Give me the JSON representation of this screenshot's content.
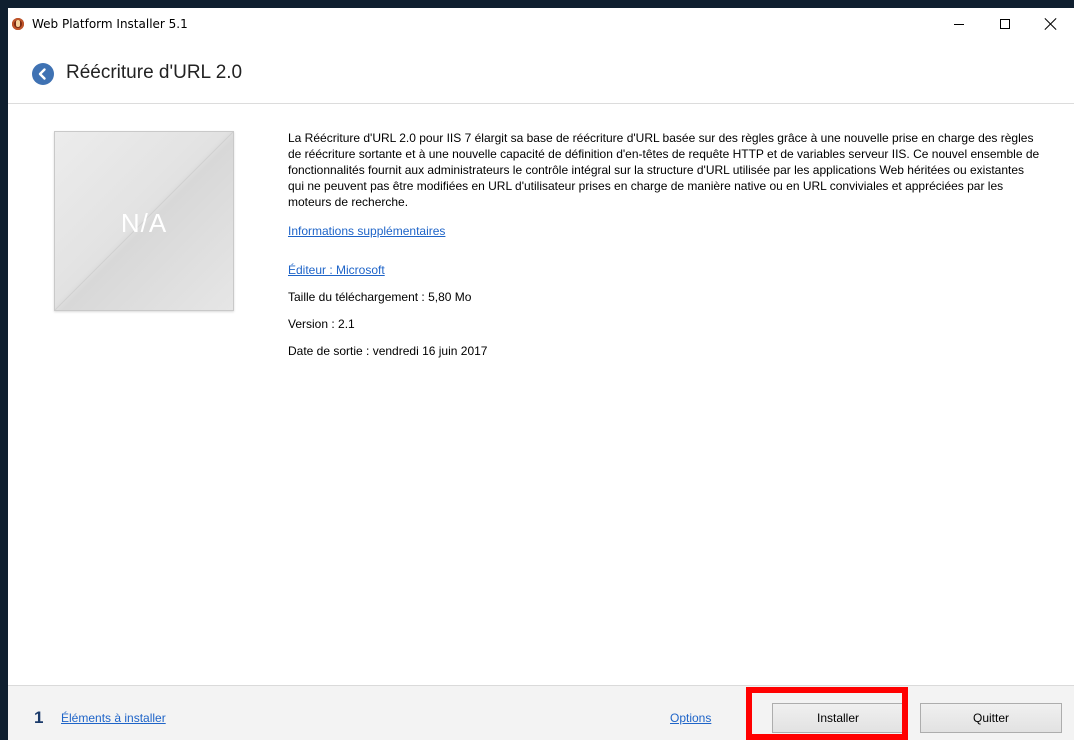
{
  "window": {
    "title": "Web Platform Installer 5.1"
  },
  "header": {
    "title": "Réécriture d'URL 2.0"
  },
  "thumbnail": {
    "label": "N/A"
  },
  "product": {
    "description": "La Réécriture d'URL 2.0 pour IIS 7 élargit sa base de réécriture d'URL basée sur des règles grâce à une nouvelle prise en charge des règles de réécriture sortante et à une nouvelle capacité de définition d'en-têtes de requête HTTP et de variables serveur IIS. Ce nouvel ensemble de fonctionnalités fournit aux administrateurs le contrôle intégral sur la structure d'URL utilisée par les applications Web héritées ou existantes qui ne peuvent pas être modifiées en URL d'utilisateur prises en charge de manière native ou en URL conviviales et appréciées par les moteurs de recherche.",
    "more_info": "Informations supplémentaires",
    "publisher": "Éditeur : Microsoft",
    "download_size": "Taille du téléchargement : 5,80 Mo",
    "version": "Version : 2.1",
    "release_date": "Date de sortie : vendredi 16 juin 2017"
  },
  "footer": {
    "count": "1",
    "items_label": "Éléments à installer",
    "options_label": "Options",
    "install_label": "Installer",
    "quit_label": "Quitter"
  },
  "colors": {
    "accent": "#3f72b3",
    "link": "#1e64c8",
    "highlight": "#ff0000"
  }
}
